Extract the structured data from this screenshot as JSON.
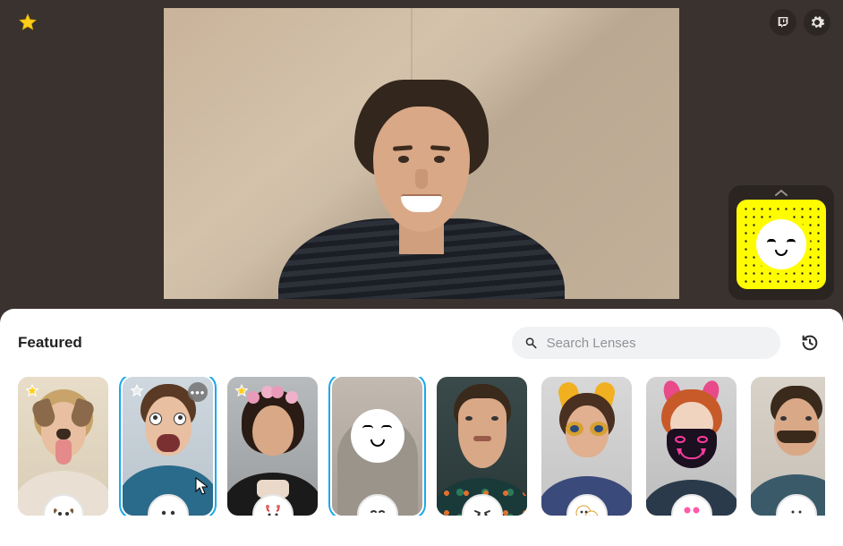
{
  "header": {
    "favorites_icon": "star-icon",
    "twitch_icon": "twitch-icon",
    "settings_icon": "gear-icon"
  },
  "snapcode": {
    "expand_icon": "chevron-up-icon"
  },
  "panel": {
    "section_title": "Featured",
    "search_placeholder": "Search Lenses",
    "history_icon": "history-icon"
  },
  "lenses": [
    {
      "id": "dog",
      "starred": true,
      "selected": false,
      "icon_label": "dog-face"
    },
    {
      "id": "bigmouth",
      "starred": true,
      "selected": true,
      "has_more": true,
      "icon_label": "smile-face"
    },
    {
      "id": "flowercrown",
      "starred": true,
      "selected": false,
      "icon_label": "bandana-face"
    },
    {
      "id": "nolens",
      "starred": false,
      "selected": true,
      "blank": true,
      "icon_label": "neutral-face"
    },
    {
      "id": "bigchin",
      "starred": false,
      "selected": false,
      "icon_label": "angry-face"
    },
    {
      "id": "kawaii",
      "starred": false,
      "selected": false,
      "icon_label": "double-face"
    },
    {
      "id": "demonmask",
      "starred": false,
      "selected": false,
      "icon_label": "mask-face"
    },
    {
      "id": "mustache",
      "starred": false,
      "selected": false,
      "icon_label": "mustache-face"
    }
  ],
  "colors": {
    "snap_yellow": "#FFFC00",
    "selection_blue": "#1aa9e8",
    "panel_bg": "#ffffff",
    "app_bg": "#3a322e"
  }
}
